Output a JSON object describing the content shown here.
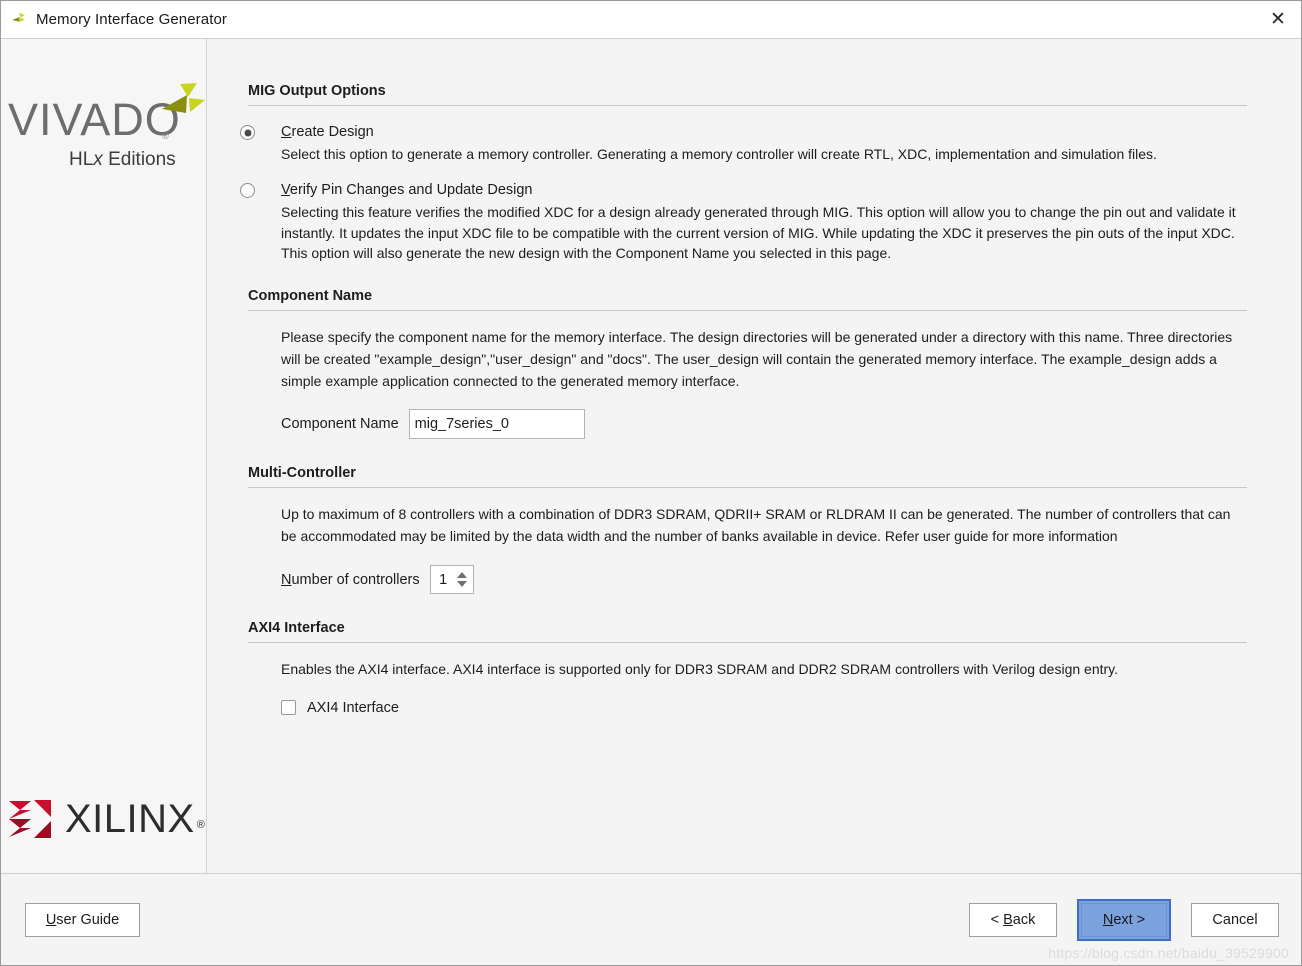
{
  "window": {
    "title": "Memory Interface Generator",
    "icon": "vivado-leaf-icon",
    "close_label": "✕"
  },
  "sidebar": {
    "vivado": {
      "wordmark": "VIVADO",
      "registered": "®",
      "edition_prefix": "HL",
      "edition_italic": "x",
      "edition_suffix": " Editions"
    },
    "xilinx": {
      "wordmark": "XILINX",
      "registered": "®"
    }
  },
  "sections": {
    "mig_output_options": {
      "title": "MIG Output Options",
      "options": [
        {
          "mnemonic": "C",
          "label_rest": "reate Design",
          "selected": true,
          "description": "Select this option to generate a memory controller. Generating a memory controller will create RTL, XDC, implementation and simulation files."
        },
        {
          "mnemonic": "V",
          "label_rest": "erify Pin Changes and Update Design",
          "selected": false,
          "description": "Selecting this feature verifies the modified XDC for a design already generated through MIG. This option will allow you to change the pin out and validate it instantly. It updates the input XDC file to be compatible with the current version of MIG. While updating the XDC it preserves the pin outs of the input XDC. This option will also generate the new design with the Component Name you selected in this page."
        }
      ]
    },
    "component_name": {
      "title": "Component Name",
      "description": "Please specify the component name for the memory interface. The design directories will be generated under a directory with this name. Three directories will be created \"example_design\",\"user_design\" and \"docs\". The user_design will contain the generated memory interface. The example_design adds a simple example application connected to the generated memory interface.",
      "field_label": "Component Name",
      "field_value": "mig_7series_0"
    },
    "multi_controller": {
      "title": "Multi-Controller",
      "description": "Up to maximum of 8 controllers with a combination of DDR3 SDRAM, QDRII+ SRAM or RLDRAM II can be generated. The number of controllers that can be accommodated may be limited by the data width and the number of banks available in device. Refer user guide for more information",
      "field_mnemonic": "N",
      "field_label_rest": "umber of controllers",
      "field_value": "1"
    },
    "axi4_interface": {
      "title": "AXI4 Interface",
      "description": "Enables the AXI4 interface. AXI4 interface is supported only for DDR3 SDRAM and DDR2 SDRAM controllers with Verilog design entry.",
      "checkbox_label": "AXI4 Interface",
      "checked": false
    }
  },
  "footer": {
    "user_guide": {
      "mnemonic": "U",
      "label_rest": "ser Guide"
    },
    "back": {
      "prefix": "< ",
      "mnemonic": "B",
      "label_rest": "ack"
    },
    "next": {
      "mnemonic": "N",
      "label_rest": "ext >"
    },
    "cancel": {
      "label": "Cancel"
    },
    "watermark": "https://blog.csdn.net/baidu_39529900"
  },
  "colors": {
    "accent_blue": "#7ba2dd",
    "accent_blue_border": "#3f6fc4",
    "xilinx_red": "#c8102e",
    "vivado_green": "#c8d420",
    "vivado_olive": "#8a8f12"
  }
}
